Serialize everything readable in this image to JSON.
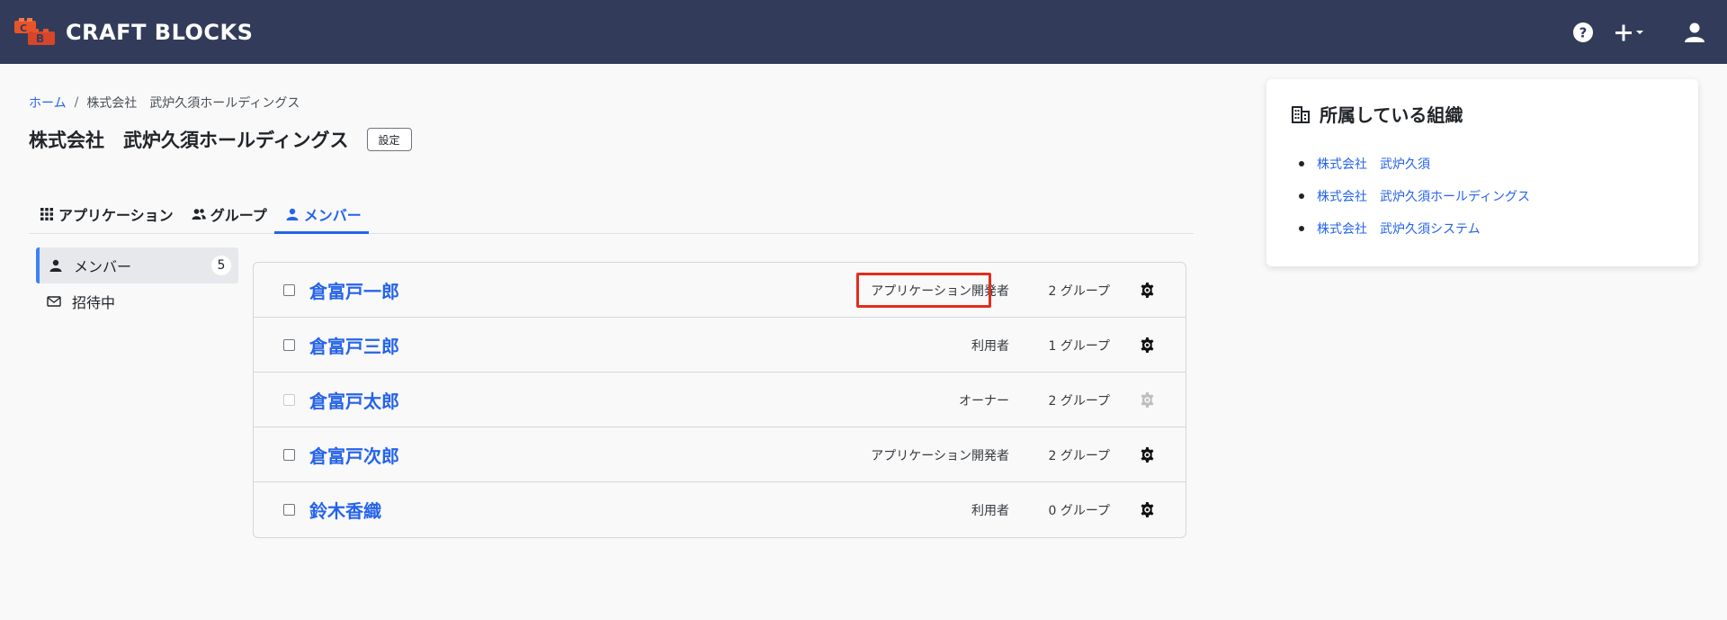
{
  "app": {
    "brand": "CRAFT BLOCKS"
  },
  "header": {
    "icons": [
      "help-icon",
      "plus-icon",
      "user-icon"
    ]
  },
  "breadcrumb": {
    "home": "ホーム",
    "separator": "/",
    "current": "株式会社　武炉久須ホールディングス"
  },
  "page": {
    "title": "株式会社　武炉久須ホールディングス",
    "settings_label": "設定"
  },
  "tabs": [
    {
      "label": "アプリケーション",
      "icon": "grid-icon",
      "active": false
    },
    {
      "label": "グループ",
      "icon": "users-icon",
      "active": false
    },
    {
      "label": "メンバー",
      "icon": "person-icon",
      "active": true
    }
  ],
  "sidebar": {
    "items": [
      {
        "label": "メンバー",
        "count": "5",
        "icon": "person-icon",
        "active": true
      },
      {
        "label": "招待中",
        "icon": "mail-icon",
        "active": false
      }
    ]
  },
  "members": [
    {
      "name": "倉富戸一郎",
      "role": "アプリケーション開発者",
      "groups": "2 グループ",
      "disabled": false,
      "highlighted": true
    },
    {
      "name": "倉富戸三郎",
      "role": "利用者",
      "groups": "1 グループ",
      "disabled": false,
      "highlighted": false
    },
    {
      "name": "倉富戸太郎",
      "role": "オーナー",
      "groups": "2 グループ",
      "disabled": true,
      "highlighted": false
    },
    {
      "name": "倉富戸次郎",
      "role": "アプリケーション開発者",
      "groups": "2 グループ",
      "disabled": false,
      "highlighted": false
    },
    {
      "name": "鈴木香織",
      "role": "利用者",
      "groups": "0 グループ",
      "disabled": false,
      "highlighted": false
    }
  ],
  "organizations": {
    "title": "所属している組織",
    "items": [
      "株式会社　武炉久須",
      "株式会社　武炉久須ホールディングス",
      "株式会社　武炉久須システム"
    ]
  },
  "colors": {
    "header_bg": "#323c5a",
    "link": "#2563eb",
    "highlight": "#e22d1d",
    "brand_orange": "#e8542a"
  }
}
